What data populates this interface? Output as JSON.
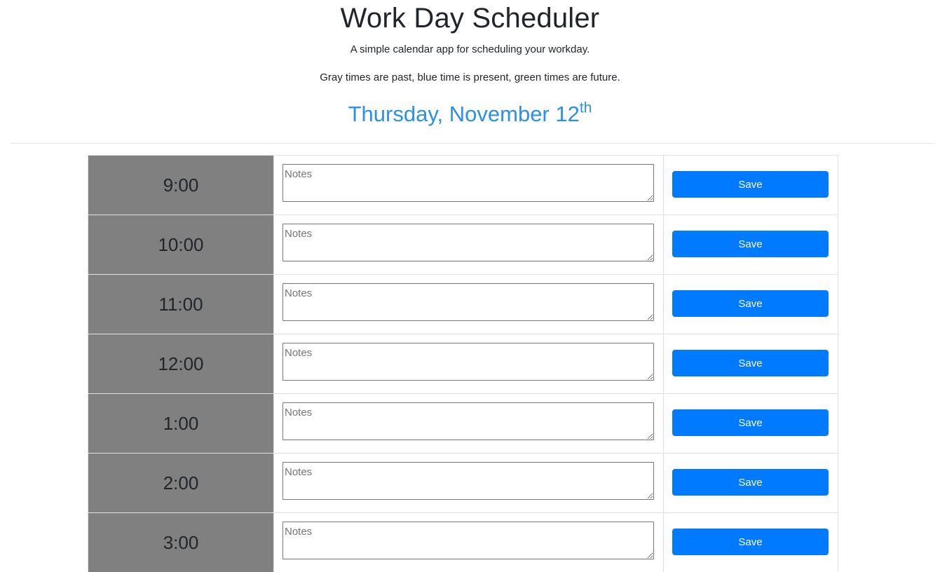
{
  "header": {
    "title": "Work Day Scheduler",
    "subtitle": "A simple calendar app for scheduling your workday.",
    "legend": "Gray times are past, blue time is present, green times are future.",
    "date": "Thursday, November 12",
    "date_suffix": "th"
  },
  "colors": {
    "past": "#808080",
    "accent": "#007bff",
    "date_text": "#2a8fef"
  },
  "rows": [
    {
      "hour": "9:00",
      "notes_value": "",
      "notes_placeholder": "Notes",
      "save_label": "Save",
      "status": "past"
    },
    {
      "hour": "10:00",
      "notes_value": "",
      "notes_placeholder": "Notes",
      "save_label": "Save",
      "status": "past"
    },
    {
      "hour": "11:00",
      "notes_value": "",
      "notes_placeholder": "Notes",
      "save_label": "Save",
      "status": "past"
    },
    {
      "hour": "12:00",
      "notes_value": "",
      "notes_placeholder": "Notes",
      "save_label": "Save",
      "status": "past"
    },
    {
      "hour": "1:00",
      "notes_value": "",
      "notes_placeholder": "Notes",
      "save_label": "Save",
      "status": "past"
    },
    {
      "hour": "2:00",
      "notes_value": "",
      "notes_placeholder": "Notes",
      "save_label": "Save",
      "status": "past"
    },
    {
      "hour": "3:00",
      "notes_value": "",
      "notes_placeholder": "Notes",
      "save_label": "Save",
      "status": "past"
    }
  ]
}
